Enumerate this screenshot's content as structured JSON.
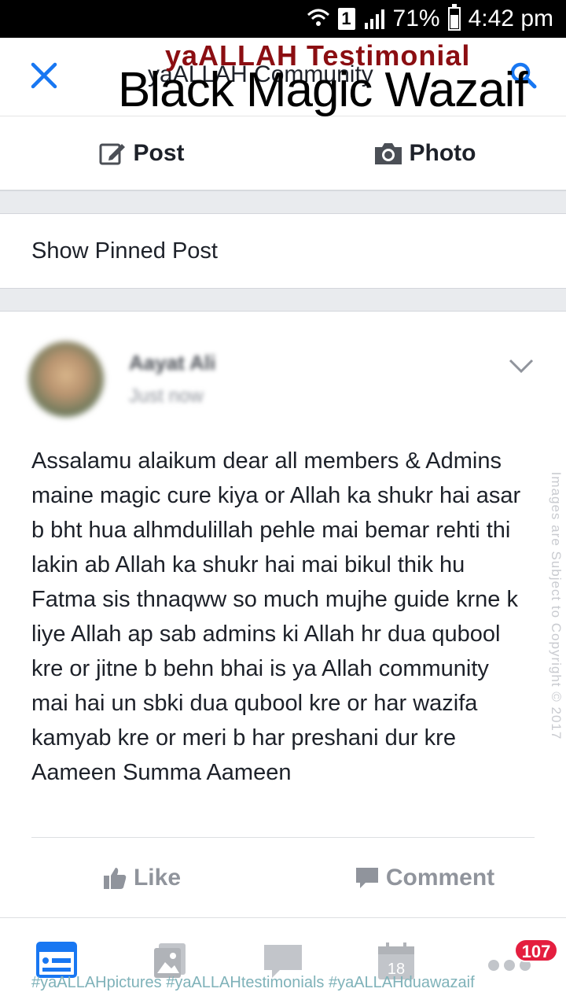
{
  "status_bar": {
    "sim_label": "1",
    "battery": "71%",
    "time": "4:42 pm"
  },
  "header": {
    "community_name": "yaALLAH Community",
    "overlay_title": "yaALLAH Testimonial",
    "overlay_subtitle": "Black Magic Wazaif"
  },
  "composer": {
    "post_label": "Post",
    "photo_label": "Photo"
  },
  "pinned": {
    "label": "Show Pinned Post"
  },
  "post": {
    "author": "Aayat Ali",
    "time": "Just now",
    "text": "Assalamu alaikum dear all members & Admins maine magic cure kiya or Allah ka shukr hai asar b bht hua alhmdulillah pehle mai bemar rehti thi lakin ab Allah ka shukr hai mai bikul thik hu Fatma sis thnaqww so much mujhe guide krne k liye Allah ap sab admins ki Allah hr dua qubool kre or jitne b behn bhai is ya Allah community mai hai un sbki dua qubool kre or har wazifa kamyab kre or meri b har preshani dur kre Aameen Summa Aameen",
    "like_label": "Like",
    "comment_label": "Comment"
  },
  "watermark": {
    "side_text": "Images are Subject to Copyright © 2017",
    "hashtags": "#yaALLAHpictures #yaALLAHtestimonials #yaALLAHduawazaif"
  },
  "bottom_nav": {
    "calendar_day": "18",
    "notification_count": "107"
  },
  "colors": {
    "accent": "#1877f2",
    "overlay_red": "#8b0e12",
    "badge": "#e41e3f",
    "muted": "#90949c"
  }
}
